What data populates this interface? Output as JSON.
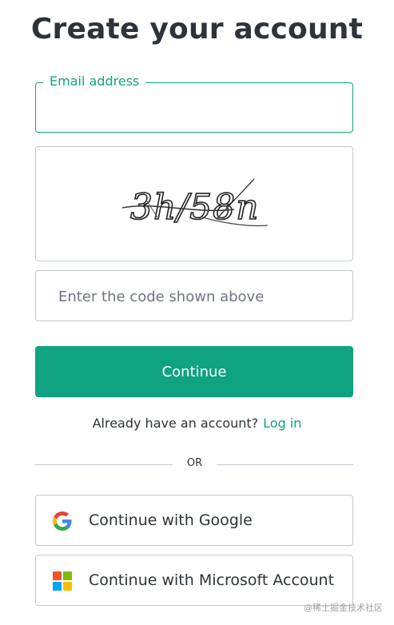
{
  "page": {
    "title": "Create your account"
  },
  "email": {
    "label": "Email address",
    "value": "",
    "placeholder": ""
  },
  "captcha": {
    "text": "3h/58n"
  },
  "code": {
    "placeholder": "Enter the code shown above",
    "value": ""
  },
  "continue_button": {
    "label": "Continue"
  },
  "login_prompt": {
    "text": "Already have an account?",
    "link": "Log in"
  },
  "divider": {
    "text": "OR"
  },
  "social": {
    "google_label": "Continue with Google",
    "google_icon": "google-icon",
    "microsoft_label": "Continue with Microsoft Account",
    "microsoft_icon": "microsoft-icon"
  },
  "watermark": {
    "text": "@稀土掘金技术社区"
  },
  "colors": {
    "accent": "#10a37f",
    "text": "#2d333a",
    "border": "#c2c8d0",
    "google_blue": "#4285F4",
    "google_red": "#EA4335",
    "google_yellow": "#FBBC05",
    "google_green": "#34A853",
    "ms_red": "#F35325",
    "ms_green": "#81BC06",
    "ms_blue": "#05A6F0",
    "ms_yellow": "#FFBA08"
  }
}
